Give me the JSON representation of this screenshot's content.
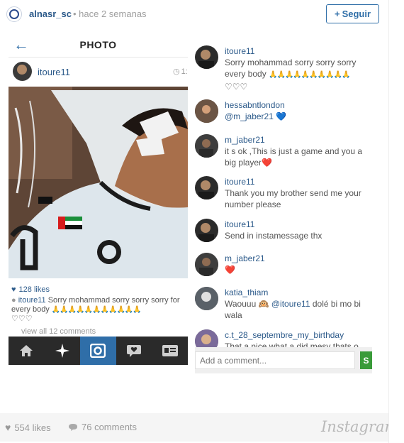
{
  "embed": {
    "owner": "alnasr_sc",
    "time": "• hace 2 semanas",
    "follow_label": "Seguir",
    "footer": {
      "likes": "554 likes",
      "comments": "76 comments",
      "logo": "Instagram"
    }
  },
  "left_screen": {
    "title": "PHOTO",
    "username": "itoure11",
    "time": "1:",
    "likes": "128 likes",
    "caption_user": "itoure11",
    "caption_text": " Sorry mohammad sorry sorry sorry for every body",
    "caption_hands": "🙏🙏🙏🙏🙏🙏🙏🙏🙏🙏🙏",
    "caption_hearts": "♡♡♡",
    "view_all": "view all 12 comments",
    "tabs": [
      "home-icon",
      "explore-icon",
      "camera-icon",
      "activity-icon",
      "profile-icon"
    ],
    "accent": "#2f6ea8"
  },
  "right_screen": {
    "comments": [
      {
        "user": "itoure11",
        "text": "Sorry mohammad sorry sorry sorry every body",
        "hands": "🙏🙏🙏🙏🙏🙏🙏🙏🙏🙏",
        "extra": "♡♡♡"
      },
      {
        "user": "hessabntlondon",
        "mention": "@m_jaber21",
        "heart": "💙"
      },
      {
        "user": "m_jaber21",
        "text": "it s ok ,This is just a game and you a big player",
        "heart": "❤️"
      },
      {
        "user": "itoure11",
        "text": "Thank you my brother send me your number please"
      },
      {
        "user": "itoure11",
        "text": "Send in instamessage thx"
      },
      {
        "user": "m_jaber21",
        "heart": "❤️"
      },
      {
        "user": "katia_thiam",
        "text_pre": "Waouuu 🙉 ",
        "mention": "@itoure11",
        "text_post": " dolé bi mo bi wala"
      },
      {
        "user": "c.t_28_septembre_my_birthday",
        "text": "That a nice what a did mesy thats o"
      }
    ],
    "comment_placeholder": "Add a comment...",
    "send_label": "S"
  }
}
